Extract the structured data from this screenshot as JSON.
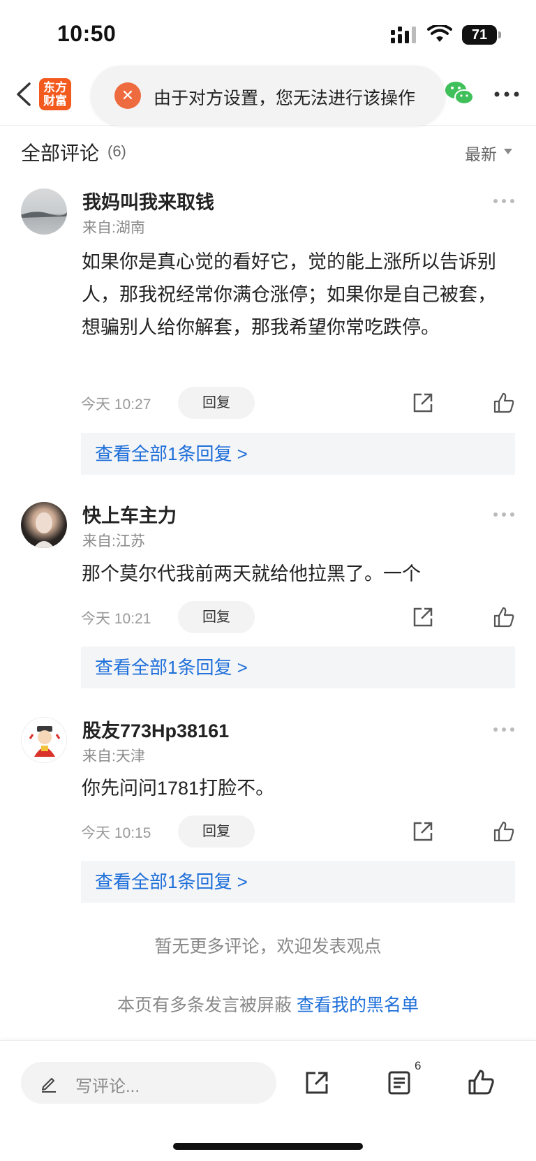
{
  "status_bar": {
    "time": "10:50",
    "battery": "71"
  },
  "nav": {
    "logo_text_line1": "东方",
    "logo_text_line2": "财富",
    "toast_message": "由于对方设置，您无法进行该操作"
  },
  "comments_header": {
    "title": "全部评论",
    "count": "(6)",
    "sort_label": "最新"
  },
  "comments": [
    {
      "user": "我妈叫我来取钱",
      "origin": "来自:湖南",
      "text": "如果你是真心觉的看好它，觉的能上涨所以告诉别人，那我祝经常你满仓涨停；如果你是自己被套，想骗别人给你解套，那我希望你常吃跌停。",
      "time": "今天 10:27",
      "reply_label": "回复",
      "replies_link": "查看全部1条回复 >"
    },
    {
      "user": "快上车主力",
      "origin": "来自:江苏",
      "text": "那个莫尔代我前两天就给他拉黑了。一个",
      "time": "今天 10:21",
      "reply_label": "回复",
      "replies_link": "查看全部1条回复 >"
    },
    {
      "user": "股友773Hp38161",
      "origin": "来自:天津",
      "text": "你先问问1781打脸不。",
      "time": "今天 10:15",
      "reply_label": "回复",
      "replies_link": "查看全部1条回复 >"
    }
  ],
  "footer_notes": {
    "no_more": "暂无更多评论，欢迎发表观点",
    "blocked_text": "本页有多条发言被屏蔽",
    "blacklist_link": "查看我的黑名单"
  },
  "bottom_bar": {
    "input_placeholder": "写评论...",
    "comment_count_badge": "6"
  },
  "colors": {
    "link_blue": "#1e6fd9",
    "brand_orange": "#f25a1e",
    "toast_x": "#ee6a3f"
  }
}
